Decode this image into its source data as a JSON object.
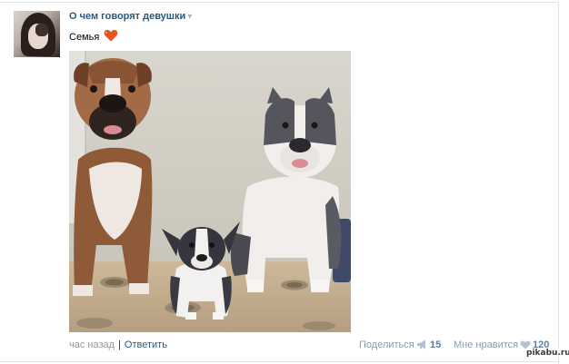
{
  "post": {
    "community_name": "О чем говорят девушки",
    "caret": "▾",
    "text": "Семья",
    "heart_icon": "heart-icon",
    "heart_color": "#e8531f"
  },
  "footer": {
    "time": "час назад",
    "separator": "|",
    "reply_label": "Ответить",
    "share_label": "Поделиться",
    "share_count": "15",
    "like_label": "Мне нравится",
    "like_count": "120"
  },
  "watermark": "pikabu.ru",
  "colors": {
    "link": "#2b587a",
    "muted": "#8c9bb0",
    "count": "#5d7d9c"
  }
}
